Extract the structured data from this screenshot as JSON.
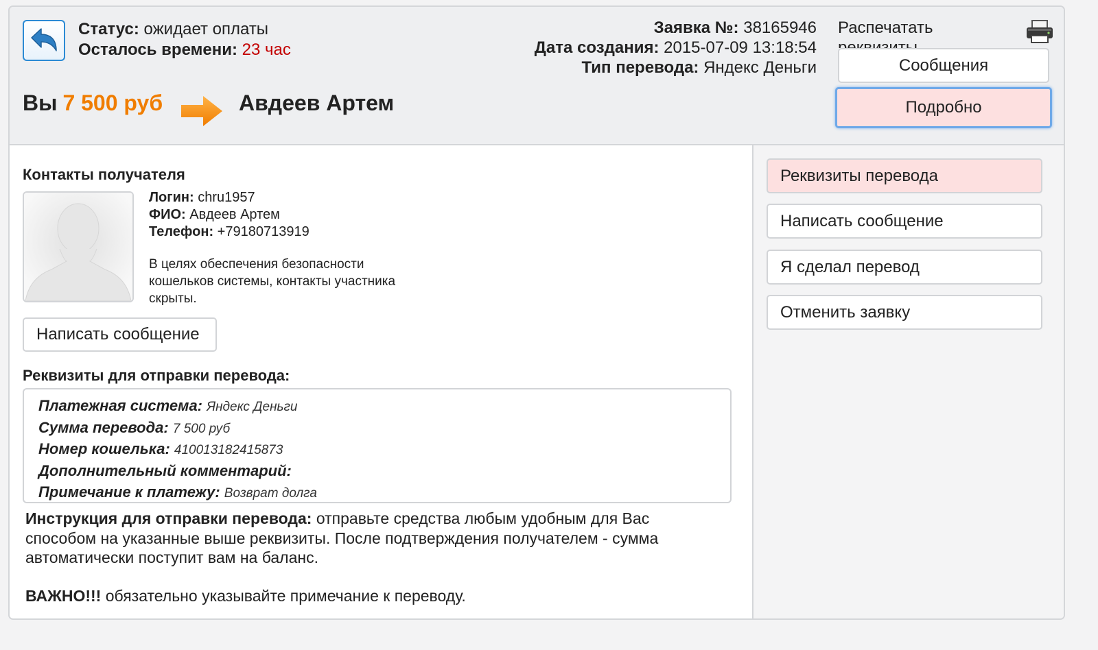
{
  "header": {
    "status_label": "Статус:",
    "status_value": "ожидает оплаты",
    "time_left_label": "Осталось времени:",
    "time_left_value": "23 час",
    "order_label": "Заявка №:",
    "order_value": "38165946",
    "created_label": "Дата создания:",
    "created_value": "2015-07-09 13:18:54",
    "transfer_type_label": "Тип перевода:",
    "transfer_type_value": "Яндекс Деньги",
    "print_label": "Распечатать реквизиты",
    "messages_button": "Сообщения",
    "details_button": "Подробно",
    "you_label": "Вы",
    "amount": "7 500 руб",
    "recipient": "Авдеев Артем",
    "colors": {
      "accent_orange": "#f07d00",
      "time_red": "#c30000",
      "active_pink": "#fde0e0",
      "focus_blue": "#6fa9e8"
    }
  },
  "contacts": {
    "title": "Контакты получателя",
    "login_label": "Логин:",
    "login_value": "chru1957",
    "name_label": "ФИО:",
    "name_value": "Авдеев Артем",
    "phone_label": "Телефон:",
    "phone_value": "+79180713919",
    "privacy_note": "В целях обеспечения безопасности кошельков системы, контакты участника скрыты.",
    "write_button": "Написать сообщение"
  },
  "requisites": {
    "title": "Реквизиты для отправки перевода:",
    "payment_system_label": "Платежная система:",
    "payment_system_value": "Яндекс Деньги",
    "sum_label": "Сумма перевода:",
    "sum_value": "7 500 руб",
    "wallet_label": "Номер кошелька:",
    "wallet_value": "410013182415873",
    "comment_label": "Дополнительный комментарий:",
    "comment_value": "",
    "note_label": "Примечание к платежу:",
    "note_value": "Возврат долга"
  },
  "instruction": {
    "label": "Инструкция для отправки перевода:",
    "text": "отправьте средства любым удобным для Вас способом на указанные выше реквизиты. После подтверждения получателем - сумма автоматически поступит вам на баланс.",
    "important_label": "ВАЖНО!!!",
    "important_text": "обязательно указывайте примечание к переводу."
  },
  "sidebar": {
    "items": [
      {
        "label": "Реквизиты перевода"
      },
      {
        "label": "Написать сообщение"
      },
      {
        "label": "Я сделал перевод"
      },
      {
        "label": "Отменить заявку"
      }
    ]
  },
  "icons": {
    "back": "back-arrow-icon",
    "printer": "printer-icon",
    "transfer_arrow": "arrow-right-icon",
    "avatar": "avatar-placeholder-icon"
  }
}
